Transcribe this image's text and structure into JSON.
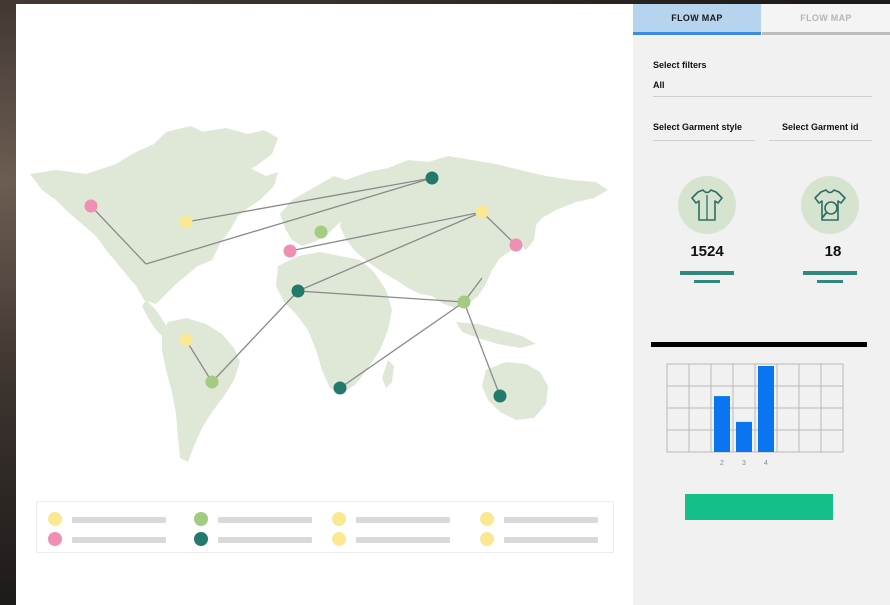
{
  "tabs": [
    {
      "label": "FLOW MAP",
      "active": true
    },
    {
      "label": "FLOW MAP",
      "active": false
    }
  ],
  "filters": {
    "select_filters_label": "Select filters",
    "select_filters_value": "All",
    "garment_style_label": "Select Garment style",
    "garment_id_label": "Select Garment id"
  },
  "stats": [
    {
      "icon": "shirt-icon",
      "value": "1524"
    },
    {
      "icon": "shirt-search-icon",
      "value": "18"
    }
  ],
  "chart_data": {
    "type": "bar",
    "categories": [
      "2",
      "3",
      "4"
    ],
    "values": [
      0.65,
      0.35,
      1.0
    ],
    "title": "",
    "xlabel": "",
    "ylabel": "",
    "grid": true,
    "color": "#0a75f0"
  },
  "map": {
    "land_color": "#dfe8d6",
    "route_color": "#8a8a8a",
    "node_colors": {
      "pink": "#ef90b3",
      "yellow": "#fae992",
      "light_green": "#a3cc82",
      "teal": "#237a6b"
    }
  },
  "legend": [
    {
      "color": "#fae992",
      "text": ""
    },
    {
      "color": "#ef90b3",
      "text": ""
    },
    {
      "color": "#a3cc82",
      "text": ""
    },
    {
      "color": "#237a6b",
      "text": ""
    },
    {
      "color": "#fae992",
      "text": ""
    },
    {
      "color": "#fae992",
      "text": ""
    },
    {
      "color": "#fae992",
      "text": ""
    },
    {
      "color": "#fae992",
      "text": ""
    }
  ],
  "colors": {
    "accent_button": "#14bf8a",
    "tab_active_bg": "#b7d4ef",
    "tab_active_border": "#3a8de0",
    "stat_bar": "#2f8a7d",
    "icon_circle": "#d6e4cf"
  }
}
